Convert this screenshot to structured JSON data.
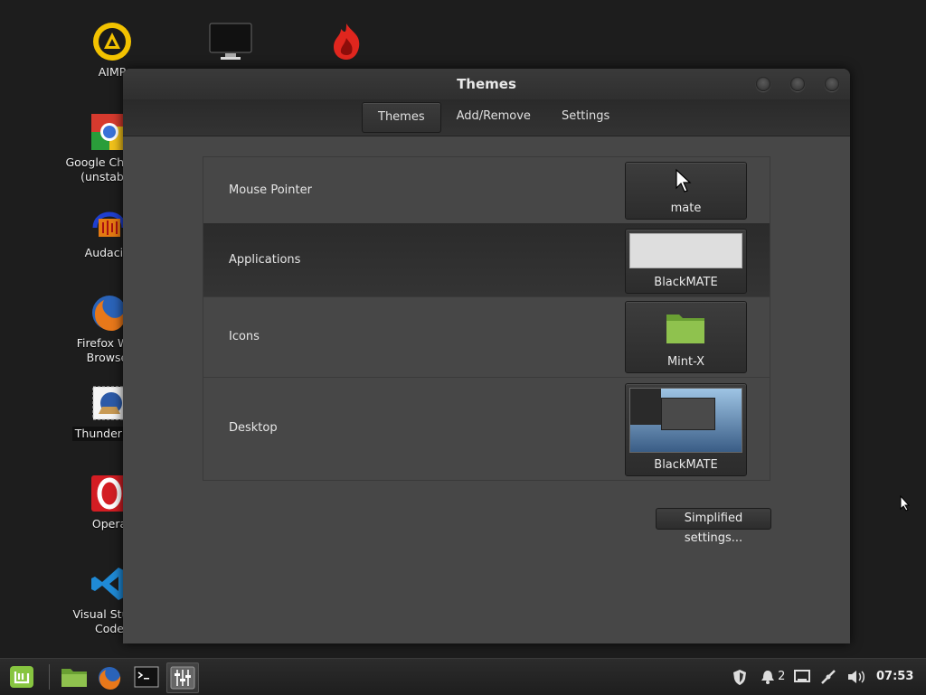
{
  "desktop": {
    "icons": [
      {
        "label": "AIMP"
      },
      {
        "label": ""
      },
      {
        "label": ""
      },
      {
        "label": "Google Chrome (unstable)"
      },
      {
        "label": "Audacity"
      },
      {
        "label": "Firefox Web Browser"
      },
      {
        "label": "Thunderbird"
      },
      {
        "label": "Opera"
      },
      {
        "label": "Visual Studio Code"
      }
    ]
  },
  "window": {
    "title": "Themes",
    "tabs": [
      {
        "label": "Themes"
      },
      {
        "label": "Add/Remove"
      },
      {
        "label": "Settings"
      }
    ],
    "rows": [
      {
        "label": "Mouse Pointer",
        "theme": "mate",
        "icon": "cursor-icon"
      },
      {
        "label": "Applications",
        "theme": "BlackMATE",
        "icon": "window-preview-icon"
      },
      {
        "label": "Icons",
        "theme": "Mint-X",
        "icon": "folder-icon"
      },
      {
        "label": "Desktop",
        "theme": "BlackMATE",
        "icon": "desktop-preview-icon"
      }
    ],
    "simplified_button": "Simplified settings..."
  },
  "taskbar": {
    "notification_count": "2",
    "clock": "07:53",
    "launchers": [
      "mint-menu-icon",
      "files-icon",
      "firefox-icon",
      "terminal-icon",
      "settings-icon"
    ]
  },
  "colors": {
    "window_bg": "#474747",
    "titlebar": "#333333",
    "folder_green": "#8fc24e"
  }
}
